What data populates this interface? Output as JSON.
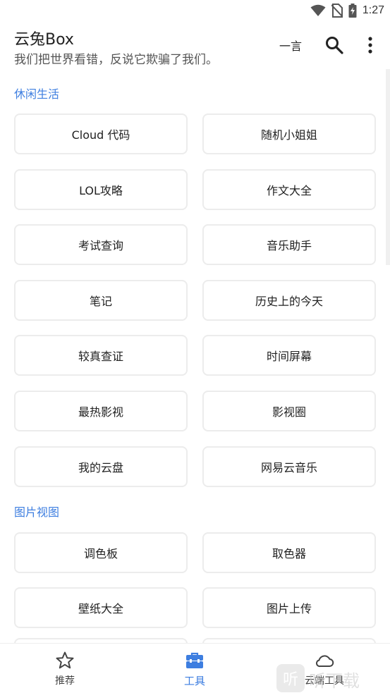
{
  "status_bar": {
    "time": "1:27",
    "icons": [
      "wifi-icon",
      "no-sim-icon",
      "battery-charging-icon"
    ]
  },
  "app_bar": {
    "title": "云兔Box",
    "subtitle": "我们把世界看错，反说它欺骗了我们。",
    "actions": {
      "yiyan_label": "一言",
      "search_icon": "search-icon",
      "more_icon": "more-vert-icon"
    }
  },
  "sections": [
    {
      "title": "休闲生活",
      "items": [
        "Cloud 代码",
        "随机小姐姐",
        "LOL攻略",
        "作文大全",
        "考试查询",
        "音乐助手",
        "笔记",
        "历史上的今天",
        "较真查证",
        "时间屏幕",
        "最热影视",
        "影视圈",
        "我的云盘",
        "网易云音乐"
      ]
    },
    {
      "title": "图片视图",
      "items": [
        "调色板",
        "取色器",
        "壁纸大全",
        "图片上传"
      ]
    }
  ],
  "bottom_nav": {
    "items": [
      {
        "label": "推荐",
        "icon": "star-outline-icon",
        "active": false
      },
      {
        "label": "工具",
        "icon": "toolbox-icon",
        "active": true
      },
      {
        "label": "云端工具",
        "icon": "cloud-outline-icon",
        "active": false
      }
    ]
  },
  "watermark": {
    "badge": "听",
    "text": "听下载"
  },
  "colors": {
    "accent": "#3d7ee0",
    "card_border": "#ececec",
    "text": "#222222"
  }
}
